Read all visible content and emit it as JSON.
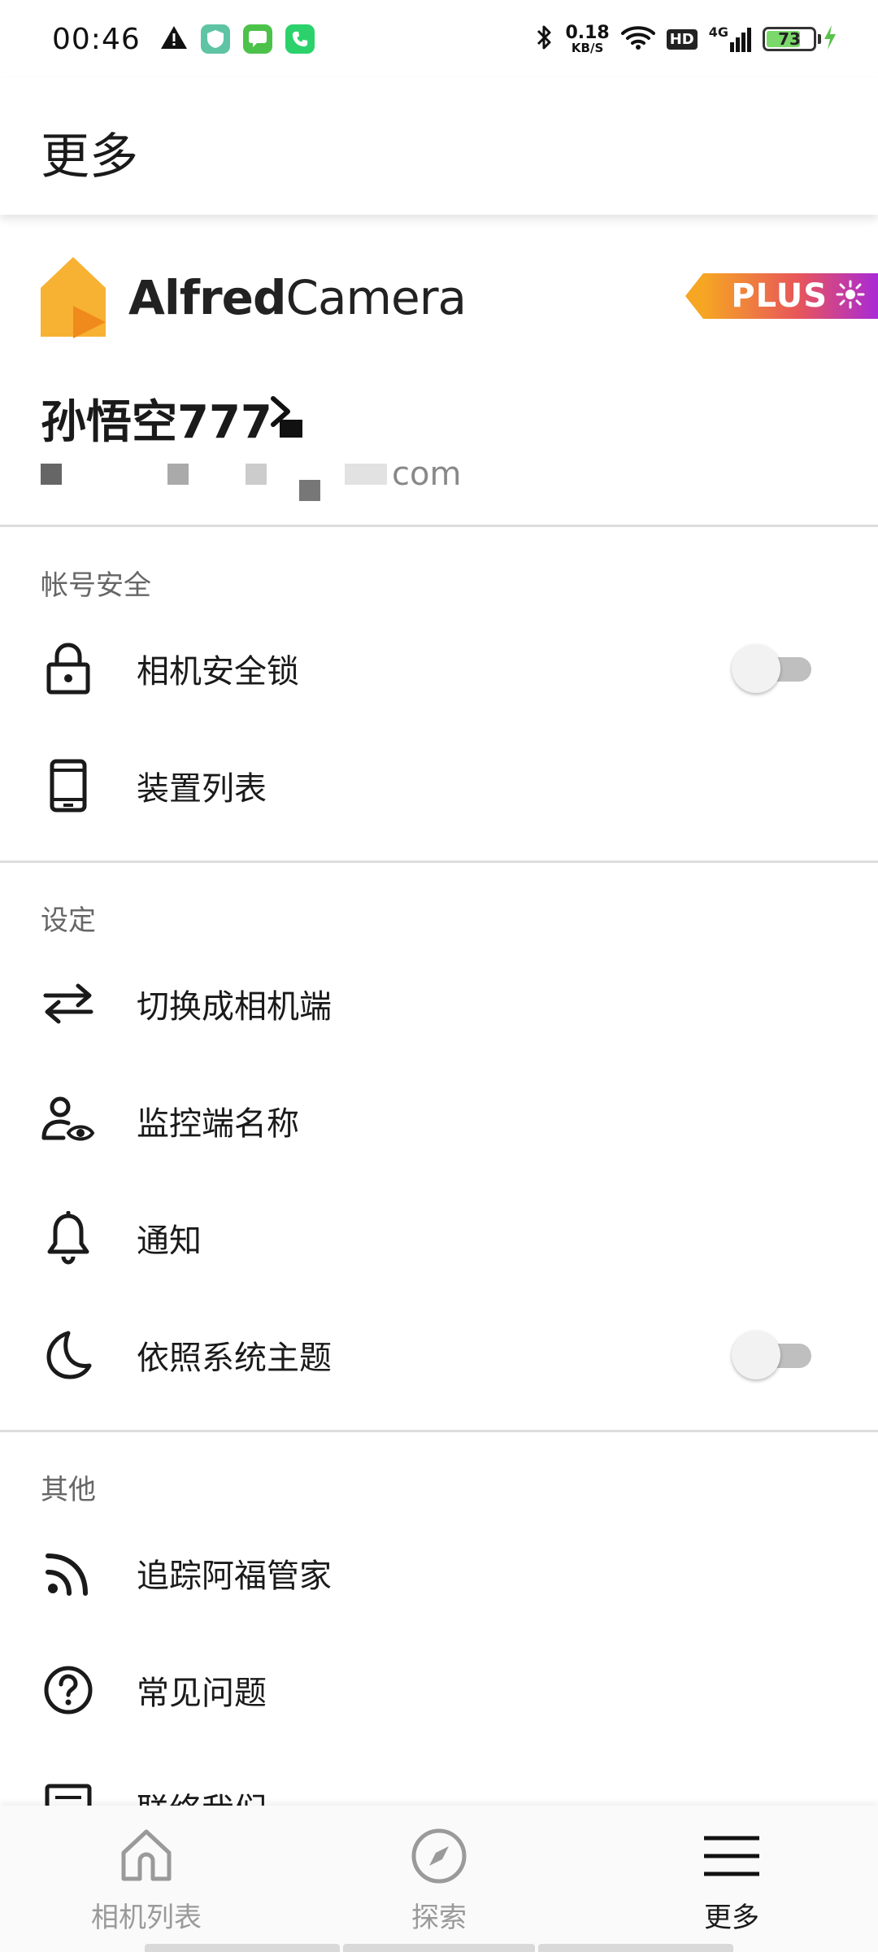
{
  "status_bar": {
    "time": "00:46",
    "net_speed_value": "0.18",
    "net_speed_unit": "KB/S",
    "hd_label": "HD",
    "signal_label": "4G",
    "battery_level": "73",
    "battery_fraction": 0.73,
    "notification_icons": [
      "warning-icon",
      "shield-app-icon",
      "message-app-icon",
      "phone-app-icon"
    ]
  },
  "app_bar": {
    "title": "更多"
  },
  "account": {
    "brand_bold": "Alfred",
    "brand_light": "Camera",
    "plus_label": "PLUS",
    "user_name": "孙悟空777",
    "email_suffix": "com"
  },
  "sections": {
    "security": {
      "title": "帐号安全",
      "items": [
        {
          "label": "相机安全锁",
          "icon": "lock-icon",
          "toggle": false
        },
        {
          "label": "装置列表",
          "icon": "phone-device-icon"
        }
      ]
    },
    "settings": {
      "title": "设定",
      "items": [
        {
          "label": "切换成相机端",
          "icon": "swap-icon"
        },
        {
          "label": "监控端名称",
          "icon": "viewer-name-icon"
        },
        {
          "label": "通知",
          "icon": "bell-icon"
        },
        {
          "label": "依照系统主题",
          "icon": "moon-icon",
          "toggle": false
        }
      ]
    },
    "other": {
      "title": "其他",
      "items": [
        {
          "label": "追踪阿福管家",
          "icon": "rss-icon"
        },
        {
          "label": "常见问题",
          "icon": "help-icon"
        },
        {
          "label": "联络我们",
          "icon": "contact-icon"
        }
      ]
    }
  },
  "bottom_nav": {
    "items": [
      {
        "label": "相机列表",
        "icon": "home-icon",
        "active": false
      },
      {
        "label": "探索",
        "icon": "compass-icon",
        "active": false
      },
      {
        "label": "更多",
        "icon": "menu-icon",
        "active": true
      }
    ]
  },
  "colors": {
    "logo_orange": "#f7b233",
    "plus_gradient_start": "#f6a623",
    "plus_gradient_end": "#a92ad6",
    "divider": "#dddddd",
    "inactive_nav": "#9a9a9a"
  }
}
